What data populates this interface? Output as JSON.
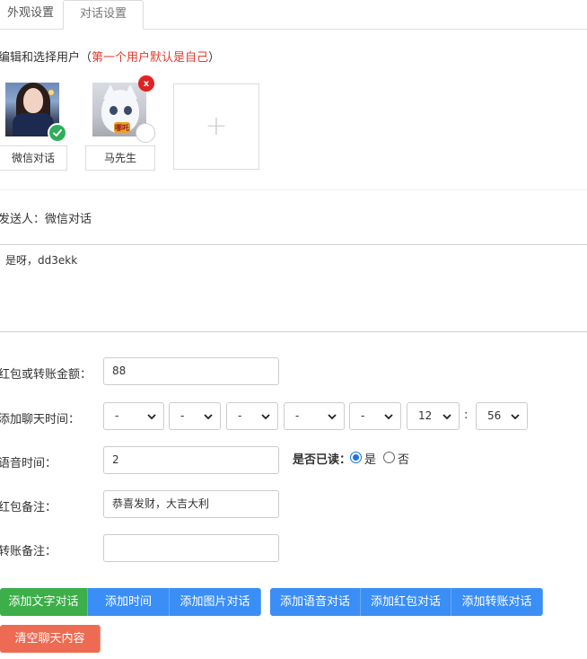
{
  "tabs": [
    {
      "label": "外观设置"
    },
    {
      "label": "对话设置"
    }
  ],
  "users_section": {
    "title_prefix": "编辑和选择用户（",
    "title_highlight": "第一个用户默认是自己",
    "title_suffix": "）"
  },
  "users": [
    {
      "name": "微信对话",
      "selected": true,
      "avatar": "girl-avatar-icon"
    },
    {
      "name": "马先生",
      "selected": false,
      "avatar": "white-cat-avatar-icon",
      "avatar_text": "哪吒"
    }
  ],
  "add_user_symbol": "+",
  "delete_symbol": "x",
  "sender": {
    "label": "发送人：微信对话"
  },
  "message": {
    "text": "是呀，dd3ekk"
  },
  "form": {
    "amount": {
      "label": "红包或转账金额：",
      "value": "88"
    },
    "chat_time": {
      "label": "添加聊天时间：",
      "selects": [
        "-",
        "-",
        "-",
        "-",
        "-",
        "12",
        "56"
      ],
      "colon": ":"
    },
    "voice_time": {
      "label": "语音时间：",
      "value": "2"
    },
    "read_status": {
      "label": "是否已读：",
      "yes": "是",
      "no": "否",
      "selected": "是"
    },
    "red_packet_note": {
      "label": "红包备注：",
      "value": "恭喜发财，大吉大利"
    },
    "transfer_note": {
      "label": "转账备注：",
      "value": ""
    }
  },
  "buttons": {
    "add_text": "添加文字对话",
    "add_time": "添加时间",
    "add_image": "添加图片对话",
    "add_voice": "添加语音对话",
    "add_red_packet": "添加红包对话",
    "add_transfer": "添加转账对话",
    "clear_chat": "清空聊天内容"
  },
  "colors": {
    "green": "#3cae4a",
    "blue": "#3a8ef6",
    "red": "#ed6b52",
    "highlight": "#e23b2e"
  }
}
